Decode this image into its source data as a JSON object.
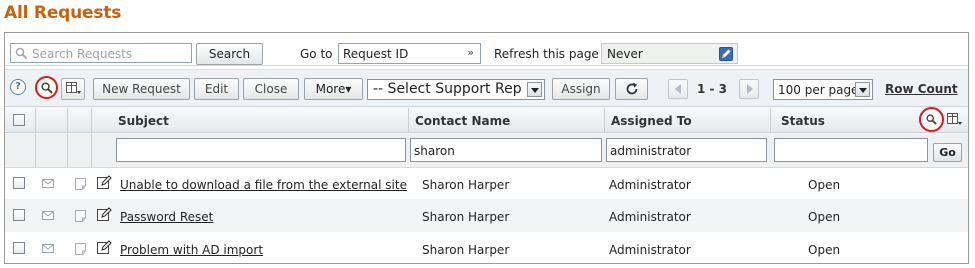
{
  "page": {
    "title": "All Requests"
  },
  "search": {
    "placeholder": "Search Requests",
    "button_label": "Search"
  },
  "goto": {
    "label": "Go to",
    "value": "Request ID",
    "arrow": "»"
  },
  "refresh": {
    "label": "Refresh this page",
    "value": "Never"
  },
  "toolbar": {
    "help": "?",
    "new_request": "New Request",
    "edit": "Edit",
    "close": "Close",
    "more": "More▾",
    "support_rep": "-- Select Support Rep",
    "assign": "Assign",
    "range": "1 - 3",
    "per_page": "100 per page",
    "row_count": "Row Count"
  },
  "table": {
    "columns": [
      "Subject",
      "Contact Name",
      "Assigned To",
      "Status"
    ],
    "filters": {
      "subject": "",
      "contact": "sharon",
      "assigned": "administrator",
      "status": "",
      "go": "Go"
    },
    "rows": [
      {
        "subject": "Unable to download a file from the external site",
        "contact": "Sharon Harper",
        "assigned": "Administrator",
        "status": "Open"
      },
      {
        "subject": "Password Reset",
        "contact": "Sharon Harper",
        "assigned": "Administrator",
        "status": "Open"
      },
      {
        "subject": "Problem with AD import",
        "contact": "Sharon Harper",
        "assigned": "Administrator",
        "status": "Open"
      }
    ]
  },
  "colors": {
    "title": "#c8620e",
    "highlight_circle": "#e01818",
    "toolbar_bg": "#eef2f6"
  }
}
